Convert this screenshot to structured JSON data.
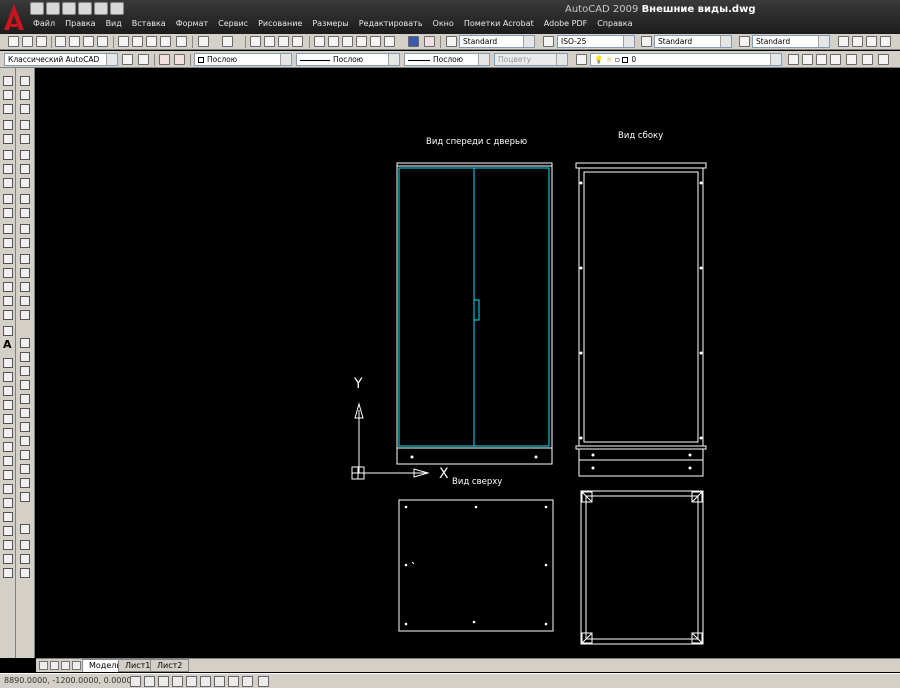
{
  "window": {
    "app_name": "AutoCAD 2009",
    "file_name": "Внешние виды.dwg"
  },
  "menu": [
    {
      "label": "Файл"
    },
    {
      "label": "Правка"
    },
    {
      "label": "Вид"
    },
    {
      "label": "Вставка"
    },
    {
      "label": "Формат"
    },
    {
      "label": "Сервис"
    },
    {
      "label": "Рисование"
    },
    {
      "label": "Размеры"
    },
    {
      "label": "Редактировать"
    },
    {
      "label": "Окно"
    },
    {
      "label": "Пометки Acrobat"
    },
    {
      "label": "Adobe PDF"
    },
    {
      "label": "Справка"
    }
  ],
  "styles_toolbar": {
    "text_style": "Standard",
    "dim_style": "ISO-25",
    "table_style": "Standard",
    "multileader_style": "Standard"
  },
  "workspace_toolbar": {
    "workspace": "Классический AutoCAD"
  },
  "properties_toolbar": {
    "color": "Послою",
    "linetype": "Послою",
    "lineweight": "Послою",
    "plot_style": "Поцвету",
    "layer": "0"
  },
  "drawing": {
    "label_front": "Вид спереди с дверью",
    "label_side": "Вид сбоку",
    "label_top": "Вид сверху",
    "ucs_y": "Y",
    "ucs_x": "X"
  },
  "layout_tabs": [
    {
      "label": "Модель",
      "active": true
    },
    {
      "label": "Лист1",
      "active": false
    },
    {
      "label": "Лист2",
      "active": false
    }
  ],
  "status": {
    "coordinates": "8890.0000, -1200.0000, 0.0000"
  },
  "colors": {
    "canvas": "#000000",
    "line_white": "#ffffff",
    "line_cyan": "#00e5ff",
    "toolbar": "#d4d0c8"
  }
}
